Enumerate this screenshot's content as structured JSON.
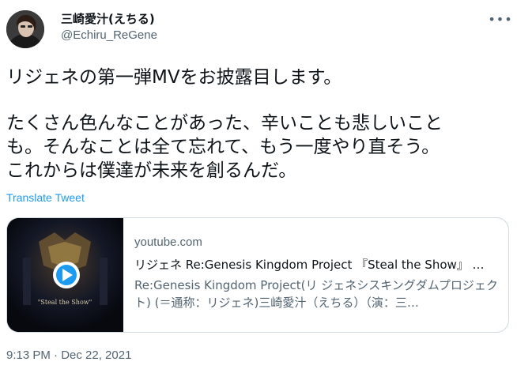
{
  "author": {
    "display_name": "三崎愛汁(えちる)",
    "handle": "@Echiru_ReGene",
    "avatar_icon": "user-avatar"
  },
  "more_icon": "more-horizontal-icon",
  "tweet": {
    "lines": [
      "リジェネの第一弾MVをお披露目します。",
      "たくさん色んなことがあった、辛いことも悲しいこと",
      "も。そんなことは全て忘れて、もう一度やり直そう。",
      "これからは僕達が未来を創るんだ。"
    ]
  },
  "translate_label": "Translate Tweet",
  "card": {
    "domain": "youtube.com",
    "title": "リジェネ Re:Genesis Kingdom Project 『Steal the Show』 …",
    "description": "Re:Genesis Kingdom Project(リ ジェネシスキングダムプロジェクト) (＝通称：リジェネ)三崎愛汁（えちる）（演：三…",
    "thumbnail_caption": "\"Steal the Show\"",
    "play_icon": "play-icon",
    "play_color": "#1d9bf0"
  },
  "timestamp": "9:13 PM · Dec 22, 2021",
  "colors": {
    "link": "#1d9bf0",
    "secondary_text": "#536471",
    "border": "#cfd9de"
  }
}
